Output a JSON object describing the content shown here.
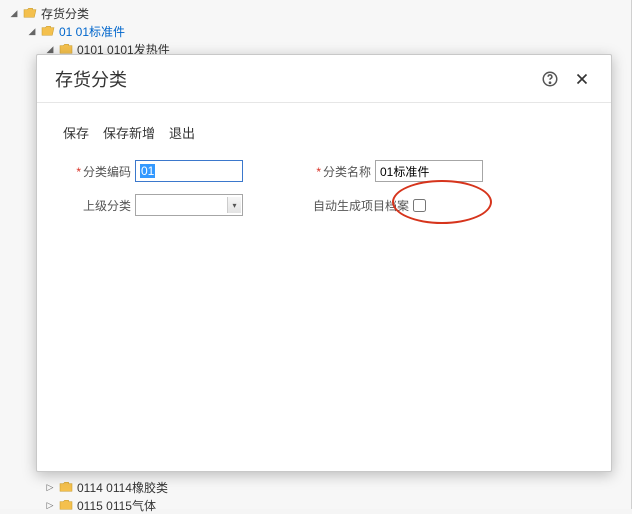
{
  "tree": {
    "root_label": "存货分类",
    "node1_label": "01 01标准件",
    "node2_label": "0101 0101发热件",
    "node3_label": "0114 0114橡胶类",
    "node4_label": "0115 0115气体"
  },
  "dialog": {
    "title": "存货分类",
    "actions": {
      "save": "保存",
      "save_new": "保存新增",
      "exit": "退出"
    },
    "form": {
      "code_label": "分类编码",
      "code_value": "01",
      "name_label": "分类名称",
      "name_value": "01标准件",
      "parent_label": "上级分类",
      "parent_value": "",
      "auto_gen_label": "自动生成项目档案"
    }
  }
}
